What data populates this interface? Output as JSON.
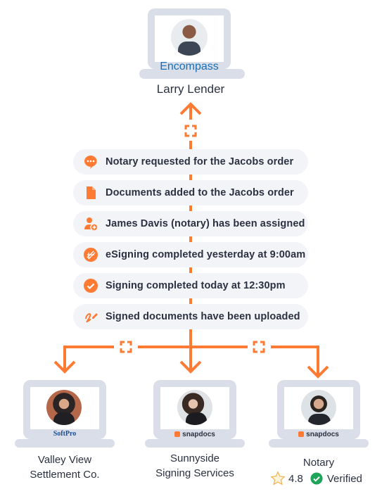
{
  "colors": {
    "accent": "#ff7a33",
    "pill_bg": "#f2f4f8",
    "laptop": "#d9dee8",
    "text": "#2b3140",
    "verified": "#1fa55a",
    "encompass_blue": "#1b6fb5",
    "softpro_blue": "#1d4f8f"
  },
  "top_node": {
    "brand": "Encompass",
    "name": "Larry Lender",
    "avatar_icon": "person-avatar"
  },
  "events": [
    {
      "icon": "chat-bubble-icon",
      "text": "Notary requested for the Jacobs order"
    },
    {
      "icon": "document-icon",
      "text": "Documents added to the Jacobs order"
    },
    {
      "icon": "user-add-icon",
      "text": "James Davis (notary) has been assigned"
    },
    {
      "icon": "esign-icon",
      "text": "eSigning completed yesterday at 9:00am"
    },
    {
      "icon": "check-circle-icon",
      "text": "Signing completed today at 12:30pm"
    },
    {
      "icon": "signature-pen-icon",
      "text": "Signed documents have been uploaded"
    }
  ],
  "bottom_nodes": [
    {
      "brand": "SoftPro",
      "name_line1": "Valley View",
      "name_line2": "Settlement Co."
    },
    {
      "brand": "snapdocs",
      "name_line1": "Sunnyside",
      "name_line2": "Signing Services"
    },
    {
      "brand": "snapdocs",
      "name_line1": "Notary",
      "rating": "4.8",
      "verified_label": "Verified"
    }
  ]
}
